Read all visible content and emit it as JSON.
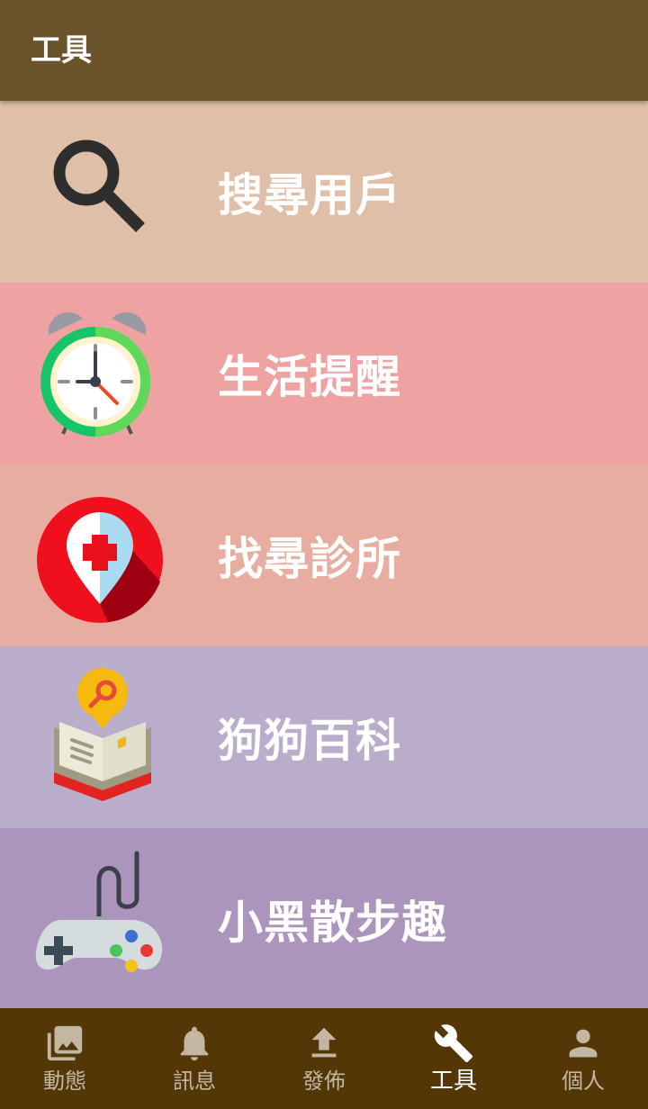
{
  "appbar": {
    "title": "工具"
  },
  "menu": {
    "items": [
      {
        "label": "搜尋用戶",
        "icon": "search-icon",
        "bg": "#dfbfa7"
      },
      {
        "label": "生活提醒",
        "icon": "alarm-clock-icon",
        "bg": "#eea3a2"
      },
      {
        "label": "找尋診所",
        "icon": "clinic-location-icon",
        "bg": "#e8ada1"
      },
      {
        "label": "狗狗百科",
        "icon": "encyclopedia-book-icon",
        "bg": "#baadcb"
      },
      {
        "label": "小黑散步趣",
        "icon": "game-controller-icon",
        "bg": "#ac95bc"
      }
    ]
  },
  "bottom_nav": {
    "items": [
      {
        "label": "動態",
        "icon": "photo-library-icon",
        "active": false
      },
      {
        "label": "訊息",
        "icon": "bell-icon",
        "active": false
      },
      {
        "label": "發佈",
        "icon": "upload-icon",
        "active": false
      },
      {
        "label": "工具",
        "icon": "wrench-icon",
        "active": true
      },
      {
        "label": "個人",
        "icon": "person-icon",
        "active": false
      }
    ]
  },
  "colors": {
    "appbar": "#6b542c",
    "bottom_nav": "#533707",
    "nav_inactive": "#c3b7a3",
    "nav_active": "#ffffff"
  }
}
